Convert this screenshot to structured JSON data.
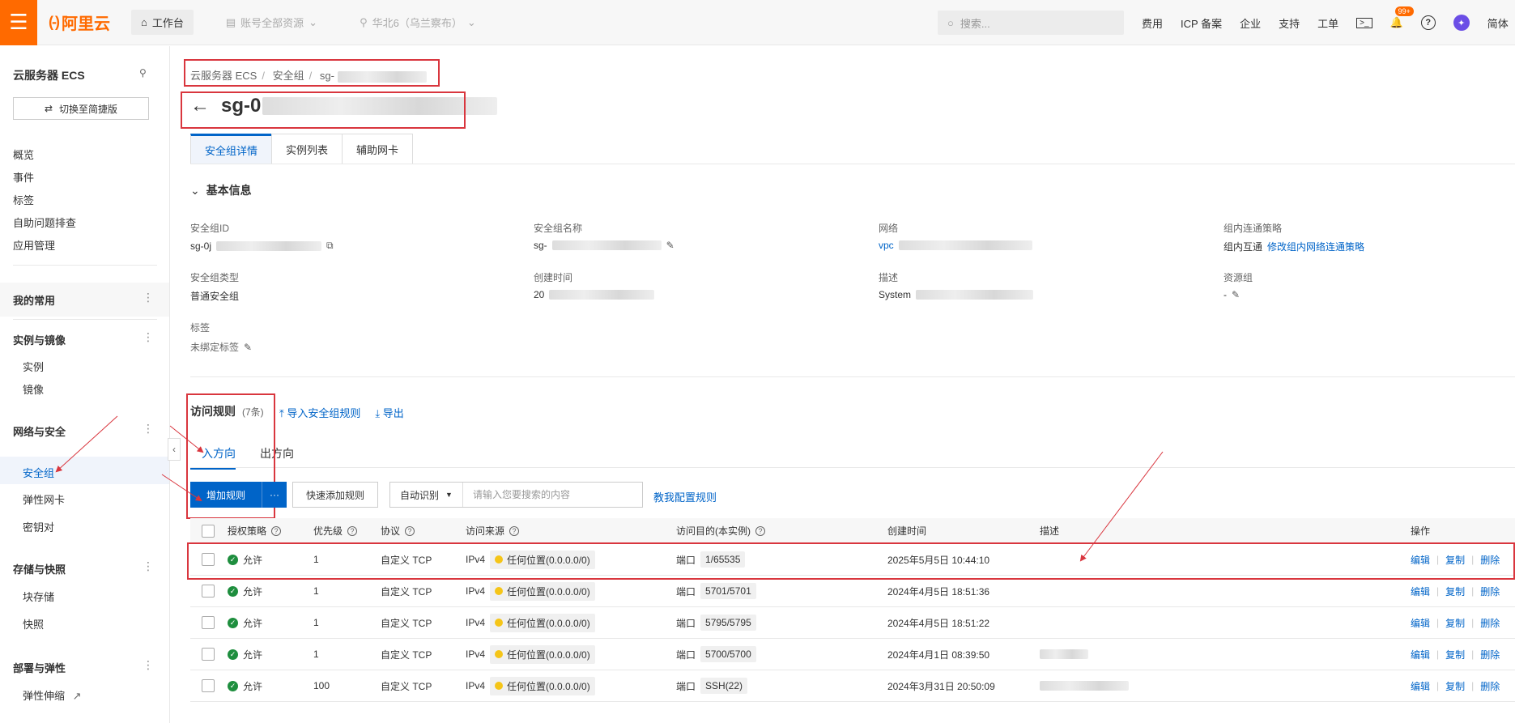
{
  "topbar": {
    "logo_text": "阿里云",
    "workbench": "工作台",
    "account_scope": "账号全部资源",
    "region": "华北6（乌兰察布）",
    "search_placeholder": "搜索...",
    "links": [
      "费用",
      "ICP 备案",
      "企业",
      "支持",
      "工单"
    ],
    "notification_badge": "99+",
    "language": "简体",
    "accent_color": "#ff6a00"
  },
  "sidebar": {
    "title": "云服务器 ECS",
    "switch_label": "切换至简捷版",
    "top_items": [
      "概览",
      "事件",
      "标签",
      "自助问题排查",
      "应用管理"
    ],
    "groups": [
      {
        "label": "我的常用",
        "items": []
      },
      {
        "label": "实例与镜像",
        "items": [
          "实例",
          "镜像"
        ]
      },
      {
        "label": "网络与安全",
        "items": [
          "安全组",
          "弹性网卡",
          "密钥对"
        ]
      },
      {
        "label": "存储与快照",
        "items": [
          "块存储",
          "快照"
        ]
      },
      {
        "label": "部署与弹性",
        "items": [
          "弹性伸缩"
        ]
      }
    ],
    "active_item": "安全组"
  },
  "breadcrumb": [
    "云服务器 ECS",
    "安全组",
    "sg-"
  ],
  "page_title": "sg-0",
  "tabs": [
    "安全组详情",
    "实例列表",
    "辅助网卡"
  ],
  "basic_info": {
    "section_title": "基本信息",
    "fields": [
      {
        "label": "安全组ID",
        "value": "sg-0j"
      },
      {
        "label": "安全组名称",
        "value": "sg-"
      },
      {
        "label": "网络",
        "value": "vpc"
      },
      {
        "label": "组内连通策略",
        "value": "组内互通",
        "link": "修改组内网络连通策略"
      },
      {
        "label": "安全组类型",
        "value": "普通安全组"
      },
      {
        "label": "创建时间",
        "value": "20"
      },
      {
        "label": "描述",
        "value": "System"
      },
      {
        "label": "资源组",
        "value": "-"
      },
      {
        "label": "标签",
        "value": "未绑定标签"
      }
    ]
  },
  "rules": {
    "title": "访问规则",
    "count": "(7条)",
    "import_label": "导入安全组规则",
    "export_label": "导出",
    "directions": [
      "入方向",
      "出方向"
    ],
    "add_rule": "增加规则",
    "more": "···",
    "quick_add": "快速添加规则",
    "auto_detect": "自动识别",
    "search_placeholder": "请输入您要搜索的内容",
    "teach_link": "教我配置规则",
    "columns": [
      "授权策略",
      "优先级",
      "协议",
      "访问来源",
      "访问目的(本实例)",
      "创建时间",
      "描述",
      "操作"
    ],
    "rows": [
      {
        "policy": "允许",
        "priority": "1",
        "protocol": "自定义 TCP",
        "ipver": "IPv4",
        "source": "任何位置(0.0.0.0/0)",
        "port_label": "端口",
        "port": "1/65535",
        "time": "2025年5月5日 10:44:10"
      },
      {
        "policy": "允许",
        "priority": "1",
        "protocol": "自定义 TCP",
        "ipver": "IPv4",
        "source": "任何位置(0.0.0.0/0)",
        "port_label": "端口",
        "port": "5701/5701",
        "time": "2024年4月5日 18:51:36"
      },
      {
        "policy": "允许",
        "priority": "1",
        "protocol": "自定义 TCP",
        "ipver": "IPv4",
        "source": "任何位置(0.0.0.0/0)",
        "port_label": "端口",
        "port": "5795/5795",
        "time": "2024年4月5日 18:51:22"
      },
      {
        "policy": "允许",
        "priority": "1",
        "protocol": "自定义 TCP",
        "ipver": "IPv4",
        "source": "任何位置(0.0.0.0/0)",
        "port_label": "端口",
        "port": "5700/5700",
        "time": "2024年4月1日 08:39:50"
      },
      {
        "policy": "允许",
        "priority": "100",
        "protocol": "自定义 TCP",
        "ipver": "IPv4",
        "source": "任何位置(0.0.0.0/0)",
        "port_label": "端口",
        "port": "SSH(22)",
        "time": "2024年3月31日 20:50:09"
      }
    ],
    "ops": [
      "编辑",
      "复制",
      "删除"
    ]
  }
}
